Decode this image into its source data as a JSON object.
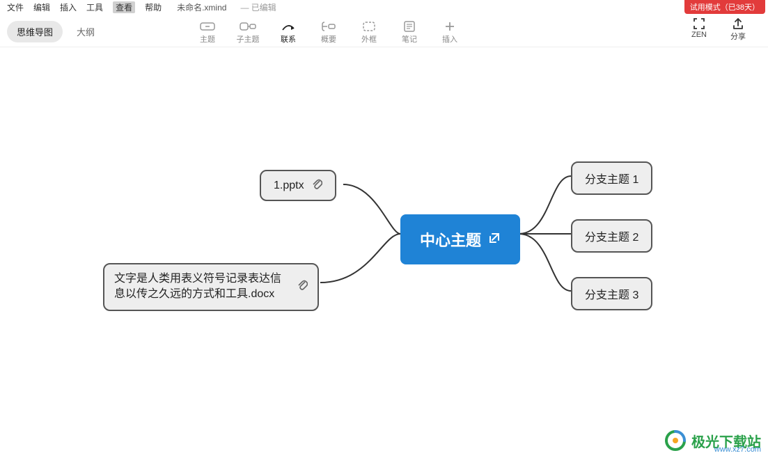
{
  "menubar": {
    "items": [
      "文件",
      "编辑",
      "插入",
      "工具",
      "查看",
      "帮助"
    ],
    "active_index": 4,
    "doc_title": "未命名.xmind",
    "doc_status": "— 已编辑"
  },
  "trial_badge": "试用模式（已38天）",
  "view_tabs": {
    "mindmap": "思维导图",
    "outline": "大纲"
  },
  "toolbar": [
    {
      "icon": "topic",
      "label": "主题"
    },
    {
      "icon": "subtopic",
      "label": "子主题"
    },
    {
      "icon": "relation",
      "label": "联系",
      "highlight": true
    },
    {
      "icon": "summary",
      "label": "概要"
    },
    {
      "icon": "boundary",
      "label": "外框"
    },
    {
      "icon": "note",
      "label": "笔记"
    },
    {
      "icon": "insert",
      "label": "插入"
    }
  ],
  "right_toolbar": [
    {
      "icon": "zen",
      "label": "ZEN"
    },
    {
      "icon": "share",
      "label": "分享"
    }
  ],
  "nodes": {
    "center": {
      "label": "中心主题",
      "has_link": true
    },
    "left1": {
      "label": "1.pptx",
      "has_attachment": true
    },
    "left2": {
      "label": "文字是人类用表义符号记录表达信息以传之久远的方式和工具.docx",
      "has_attachment": true
    },
    "right1": {
      "label": "分支主题 1"
    },
    "right2": {
      "label": "分支主题 2"
    },
    "right3": {
      "label": "分支主题 3"
    }
  },
  "watermark": {
    "text": "极光下载站",
    "url": "www.xz7.com"
  }
}
